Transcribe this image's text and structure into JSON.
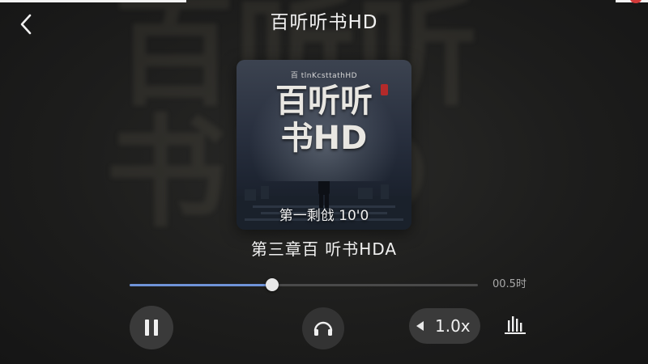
{
  "header": {
    "title": "百听听书HD",
    "back_icon": "chevron-left-icon"
  },
  "background": {
    "art_line1": "百听听",
    "art_line2": "书HD"
  },
  "cover": {
    "small_title": "百 tlnKcsttathHD",
    "title_line1": "百听听",
    "title_line2": "书HD",
    "caption": "第一剩戗 10'0"
  },
  "track": {
    "chapter_title": "第三章百 听书HDA"
  },
  "progress": {
    "fraction": 0.41,
    "time_label": "00.5时",
    "fill_color": "#6f93d8"
  },
  "controls": {
    "play_state": "playing",
    "pause_icon": "pause-icon",
    "headphones_icon": "headphones-icon",
    "speed_label": "1.0x",
    "speed_icon": "triangle-left-icon",
    "equalizer_icon": "equalizer-icon"
  }
}
